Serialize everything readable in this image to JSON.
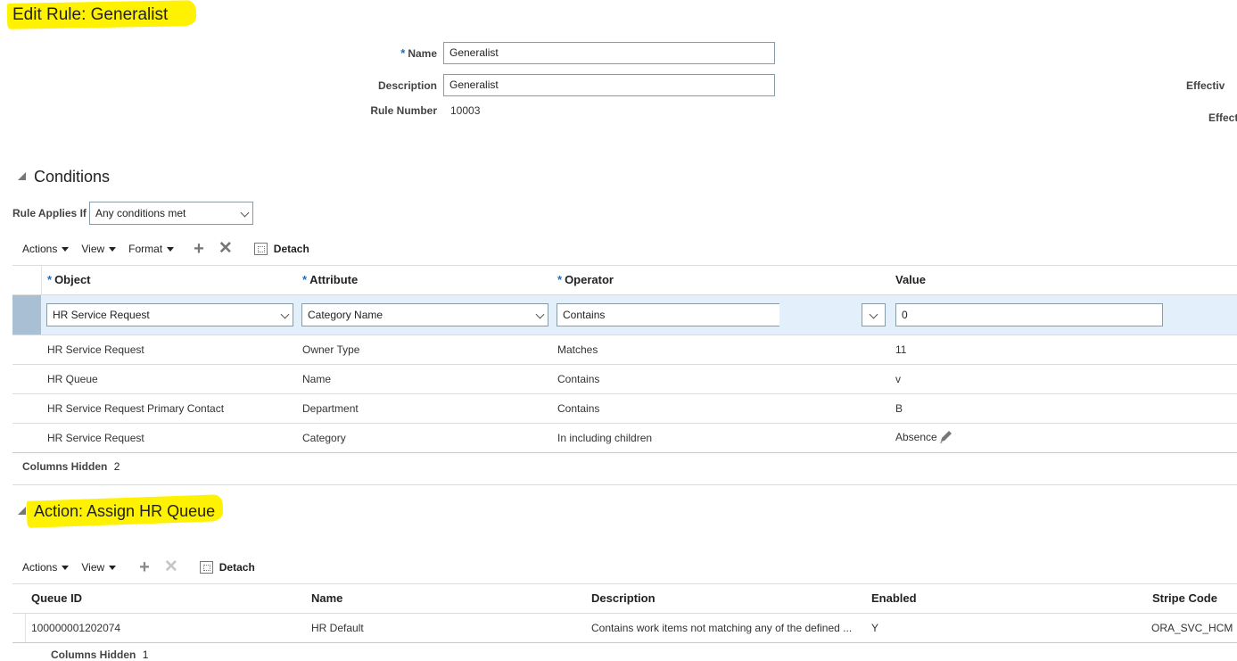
{
  "page": {
    "title": "Edit Rule: Generalist"
  },
  "form": {
    "name_label": "Name",
    "name_value": "Generalist",
    "description_label": "Description",
    "description_value": "Generalist",
    "rule_number_label": "Rule Number",
    "rule_number_value": "10003",
    "effective_label_1": "Effectiv",
    "effective_label_2": "Effect"
  },
  "conditions": {
    "section_title": "Conditions",
    "applies_label": "Rule Applies If",
    "applies_value": "Any conditions met",
    "toolbar": {
      "actions": "Actions",
      "view": "View",
      "format": "Format",
      "detach": "Detach"
    },
    "columns": {
      "object": "Object",
      "attribute": "Attribute",
      "operator": "Operator",
      "value": "Value"
    },
    "edit_row": {
      "object": "HR Service Request",
      "attribute": "Category Name",
      "operator": "Contains",
      "value": "0"
    },
    "rows": [
      {
        "object": "HR Service Request",
        "attribute": "Owner Type",
        "operator": "Matches",
        "value": "11"
      },
      {
        "object": "HR Queue",
        "attribute": "Name",
        "operator": "Contains",
        "value": "v"
      },
      {
        "object": "HR Service Request Primary Contact",
        "attribute": "Department",
        "operator": "Contains",
        "value": "B"
      },
      {
        "object": "HR Service Request",
        "attribute": "Category",
        "operator": "In including children",
        "value": "Absence"
      }
    ],
    "columns_hidden_label": "Columns Hidden",
    "columns_hidden_value": "2"
  },
  "action": {
    "section_title": "Action: Assign HR Queue",
    "toolbar": {
      "actions": "Actions",
      "view": "View",
      "detach": "Detach"
    },
    "columns": {
      "queue_id": "Queue ID",
      "name": "Name",
      "description": "Description",
      "enabled": "Enabled",
      "stripe_code": "Stripe Code"
    },
    "rows": [
      {
        "queue_id": "100000001202074",
        "name": "HR Default",
        "description": "Contains work items not matching any of the defined ...",
        "enabled": "Y",
        "stripe_code": "ORA_SVC_HCM"
      }
    ],
    "columns_hidden_label": "Columns Hidden",
    "columns_hidden_value": "1"
  },
  "colors": {
    "highlight": "#fff200",
    "selected_row": "#e3f0fb",
    "required": "#1a6fbf"
  }
}
